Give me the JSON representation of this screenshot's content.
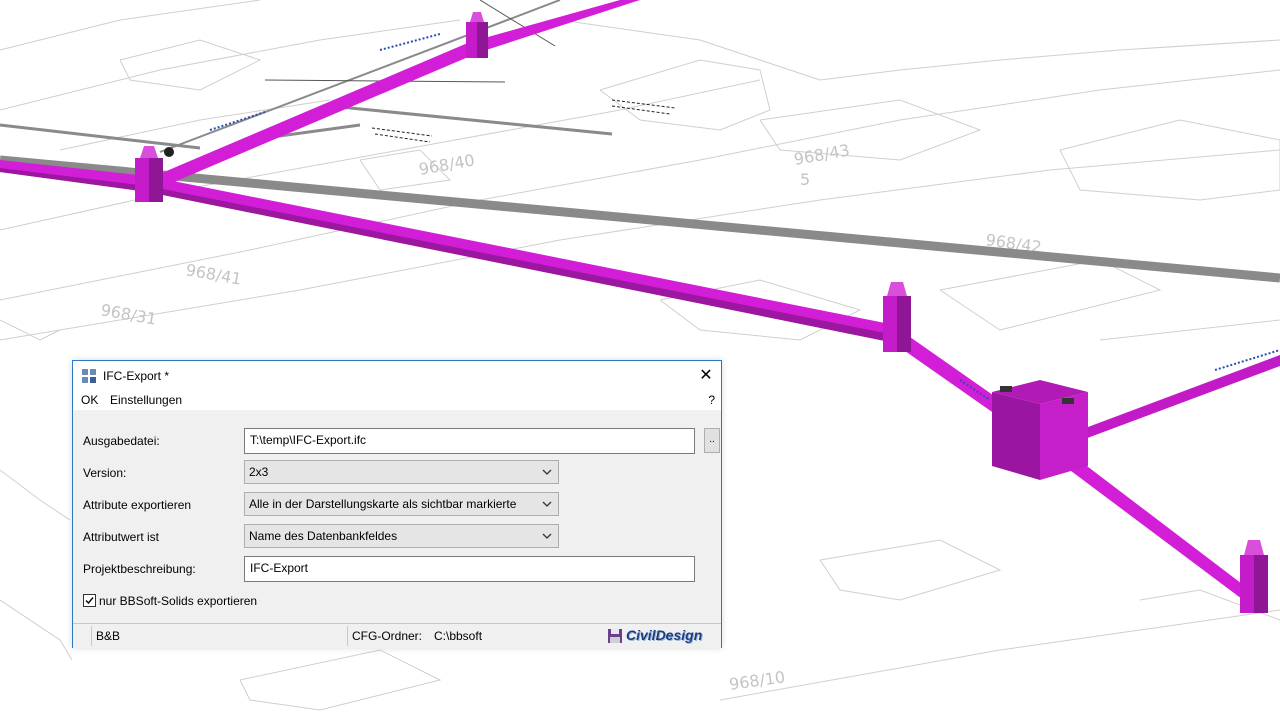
{
  "background": {
    "parcel_labels": [
      "968/40",
      "968/43",
      "968/42",
      "968/41",
      "968/31",
      "968/10",
      "5"
    ],
    "pipe_color": "#d21ed6",
    "pipe_shadow_color": "#9b17a0",
    "cable_color": "#8a8a8a",
    "line_color": "#c8c8c8"
  },
  "dialog": {
    "title": "IFC-Export *",
    "close_symbol": "✕",
    "menu": {
      "ok": "OK",
      "settings": "Einstellungen",
      "help": "?"
    },
    "fields": {
      "output_file": {
        "label": "Ausgabedatei:",
        "value": "T:\\temp\\IFC-Export.ifc",
        "browse": ".."
      },
      "version": {
        "label": "Version:",
        "value": "2x3"
      },
      "export_attributes": {
        "label": "Attribute exportieren",
        "value": "Alle in der Darstellungskarte als sichtbar markierte"
      },
      "attribute_value": {
        "label": "Attributwert ist",
        "value": "Name des Datenbankfeldes"
      },
      "project_description": {
        "label": "Projektbeschreibung:",
        "value": "IFC-Export"
      }
    },
    "checkbox": {
      "label": "nur BBSoft-Solids exportieren",
      "checked": true,
      "mark": "✓"
    },
    "status": {
      "user": "B&B",
      "cfg_label": "CFG-Ordner:",
      "cfg_value": "C:\\bbsoft",
      "brand": "CivilDesign"
    },
    "accent_color": "#2b79c2"
  }
}
